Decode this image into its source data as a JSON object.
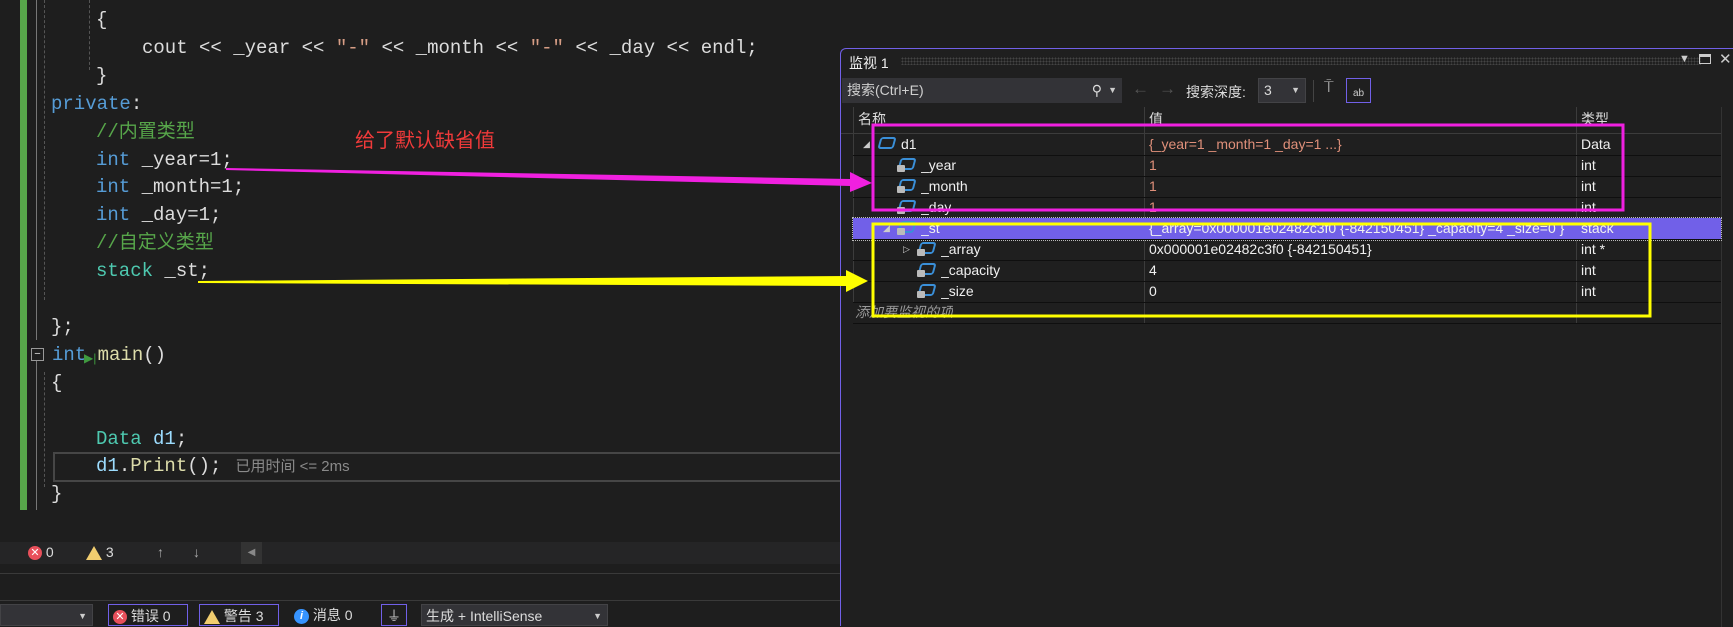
{
  "editor": {
    "lines": [
      [
        [
          "{",
          "t-tx"
        ]
      ],
      [
        [
          "cout << _year << ",
          "t-tx"
        ],
        [
          "\"-\"",
          "t-str"
        ],
        [
          " << _month << ",
          "t-tx"
        ],
        [
          "\"-\"",
          "t-str"
        ],
        [
          " << _day << endl;",
          "t-tx"
        ]
      ],
      [
        [
          "}",
          "t-tx"
        ]
      ],
      [
        [
          "private",
          "t-kw"
        ],
        [
          ":",
          "t-tx"
        ]
      ],
      [
        [
          "//内置类型",
          "t-cm"
        ]
      ],
      [
        [
          "int",
          "t-kw"
        ],
        [
          " _year=1;",
          "t-tx"
        ]
      ],
      [
        [
          "int",
          "t-kw"
        ],
        [
          " _month=1;",
          "t-tx"
        ]
      ],
      [
        [
          "int",
          "t-kw"
        ],
        [
          " _day=1;",
          "t-tx"
        ]
      ],
      [
        [
          "//自定义类型",
          "t-cm"
        ]
      ],
      [
        [
          "stack",
          "t-type"
        ],
        [
          " _st;",
          "t-tx"
        ]
      ],
      [],
      [
        [
          "};",
          "t-tx"
        ]
      ],
      [
        [
          "int",
          "t-kw"
        ],
        [
          " ",
          "t-tx"
        ],
        [
          "main",
          "t-fn"
        ],
        [
          "()",
          "t-tx"
        ]
      ],
      [
        [
          "{",
          "t-tx"
        ]
      ],
      [],
      [
        [
          "Data",
          "t-type"
        ],
        [
          " ",
          "t-tx"
        ],
        [
          "d1",
          "t-var"
        ],
        [
          ";",
          "t-tx"
        ]
      ],
      [
        [
          "d1",
          "t-var"
        ],
        [
          ".",
          "t-tx"
        ],
        [
          "Print",
          "t-fn"
        ],
        [
          "();",
          "t-tx"
        ]
      ],
      [
        [
          "}",
          "t-tx"
        ]
      ]
    ],
    "indents": [
      2,
      3,
      2,
      1,
      2,
      2,
      2,
      2,
      2,
      2,
      0,
      1,
      1,
      1,
      0,
      2,
      2,
      1
    ],
    "elapsed_hint": "已用时间 <= 2ms",
    "annotation": "给了默认缺省值"
  },
  "error_bar": {
    "errors": "0",
    "warnings": "3"
  },
  "bottom_bar": {
    "errors_label": "错误 0",
    "warnings_label": "警告 3",
    "messages_label": "消息 0",
    "build_source": "生成 + IntelliSense"
  },
  "watch": {
    "title": "监视 1",
    "search_placeholder": "搜索(Ctrl+E)",
    "depth_label": "搜索深度:",
    "depth_value": "3",
    "columns": {
      "name": "名称",
      "value": "值",
      "type": "类型"
    },
    "rows": [
      {
        "name": "d1",
        "value": "{_year=1 _month=1 _day=1 ...}",
        "type": "Data",
        "level": 0,
        "expander": "expanded",
        "changed": true
      },
      {
        "name": "_year",
        "value": "1",
        "type": "int",
        "level": 1,
        "expander": "none",
        "changed": true
      },
      {
        "name": "_month",
        "value": "1",
        "type": "int",
        "level": 1,
        "expander": "none",
        "changed": true
      },
      {
        "name": "_day",
        "value": "1",
        "type": "int",
        "level": 1,
        "expander": "none",
        "changed": true
      },
      {
        "name": "_st",
        "value": "{_array=0x000001e02482c3f0 {-842150451} _capacity=4 _size=0 }",
        "type": "stack",
        "level": 1,
        "expander": "expanded",
        "selected": true
      },
      {
        "name": "_array",
        "value": "0x000001e02482c3f0 {-842150451}",
        "type": "int *",
        "level": 2,
        "expander": "collapsed"
      },
      {
        "name": "_capacity",
        "value": "4",
        "type": "int",
        "level": 2,
        "expander": "none"
      },
      {
        "name": "_size",
        "value": "0",
        "type": "int",
        "level": 2,
        "expander": "none"
      }
    ],
    "add_item_placeholder": "添加要监视的项"
  },
  "colors": {
    "accent": "#7160e8",
    "annotation_magenta": "#f020e0",
    "annotation_yellow": "#ffff00",
    "annotation_text": "#f03a3a"
  }
}
